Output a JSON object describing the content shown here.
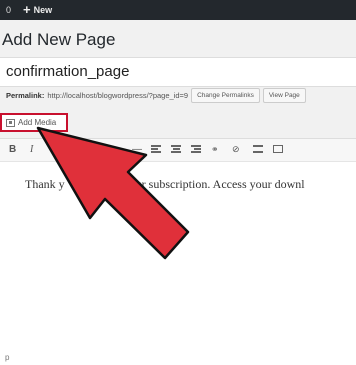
{
  "adminbar": {
    "comment_count": "0",
    "new_label": "New"
  },
  "page": {
    "title": "Add New Page"
  },
  "post": {
    "title_value": "confirmation_page"
  },
  "permalink": {
    "label": "Permalink:",
    "url": "http://localhost/blogwordpress/?page_id=9",
    "change_button": "Change Permalinks",
    "view_button": "View Page"
  },
  "media": {
    "add_label": "Add Media"
  },
  "toolbar": {
    "bold": "B",
    "italic": "I"
  },
  "editor": {
    "content_left": "Thank y",
    "content_right": "g your subscription. Access your downl"
  },
  "footer": {
    "path": "p"
  },
  "colors": {
    "highlight": "#c8102e",
    "arrow": "#e0303a",
    "adminbar": "#23282d"
  }
}
